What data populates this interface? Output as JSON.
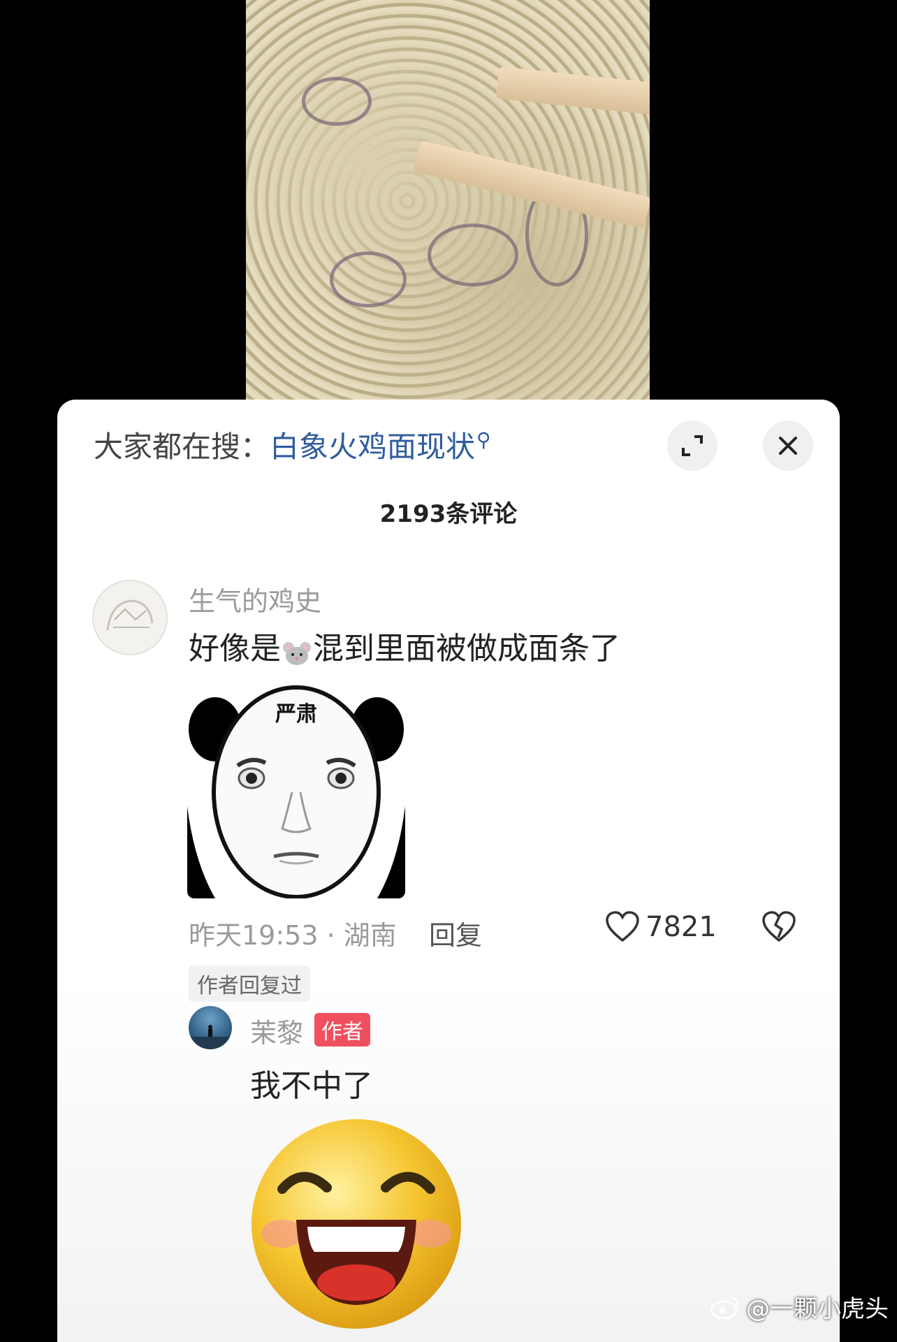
{
  "search": {
    "prefix": "大家都在搜：",
    "query": "白象火鸡面现状",
    "search_icon": "search-icon"
  },
  "header": {
    "expand_icon": "expand-icon",
    "close_icon": "close-icon",
    "comment_count": "2193条评论"
  },
  "comment": {
    "username": "生气的鸡史",
    "text_before": "好像是",
    "emoji": "mouse-emoji",
    "text_after": "混到里面被做成面条了",
    "sticker_caption": "严肃",
    "time": "昨天19:53",
    "location": "湖南",
    "separator": " · ",
    "reply_label": "回复",
    "likes": "7821",
    "author_replied_label": "作者回复过"
  },
  "reply": {
    "username": "茉黎",
    "badge": "作者",
    "text": "我不中了"
  },
  "watermark": {
    "text": "@一颗小虎头"
  },
  "colors": {
    "link": "#2f5d9e",
    "badge": "#f0505e"
  }
}
